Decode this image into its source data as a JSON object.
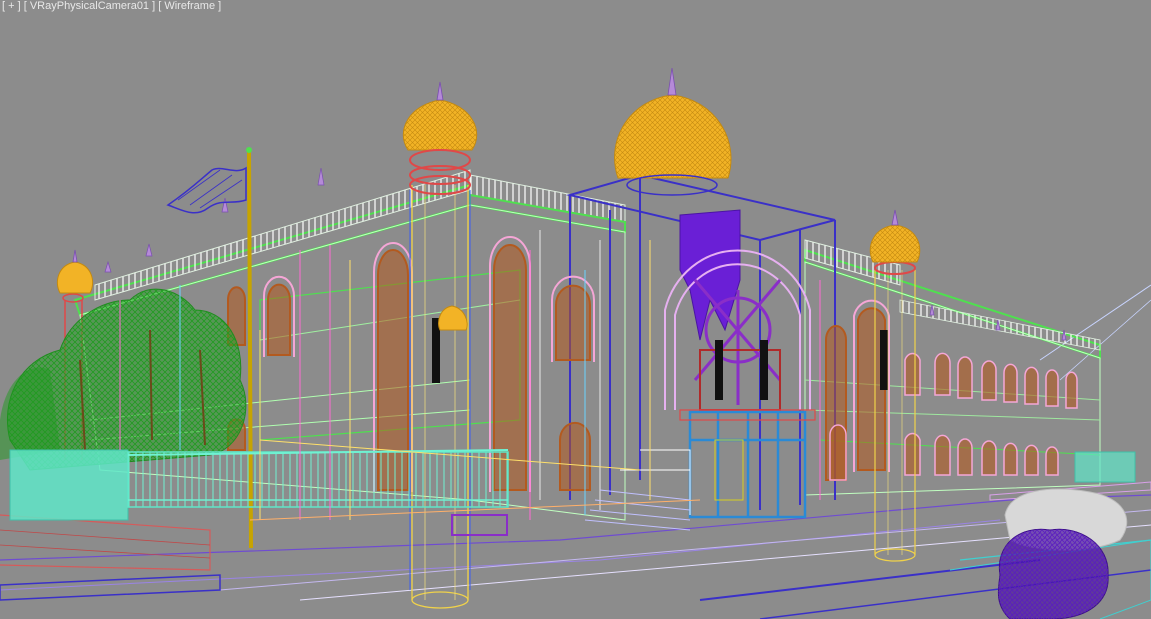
{
  "viewport": {
    "menus": [
      {
        "label": "[ + ]"
      },
      {
        "label": "[ VRayPhysicalCamera01 ]"
      },
      {
        "label": "[ Wireframe ]"
      }
    ],
    "shading_mode": "wireframe"
  },
  "colors": {
    "background": "#8c8c8c",
    "dome": "#f2b326",
    "cornice": "#4fe04f",
    "balustrade": "#e0f0e0",
    "window_frame": "#b35a1f",
    "window_outline": "#f5a6d6",
    "fence": "#5fe6c8",
    "tree": "#2aa12a",
    "shrub": "#4b14a3",
    "frame": "#3a30c8",
    "ground": "#6f4cd1",
    "rock": "#d8d8d8",
    "pole": "#c7a400"
  }
}
